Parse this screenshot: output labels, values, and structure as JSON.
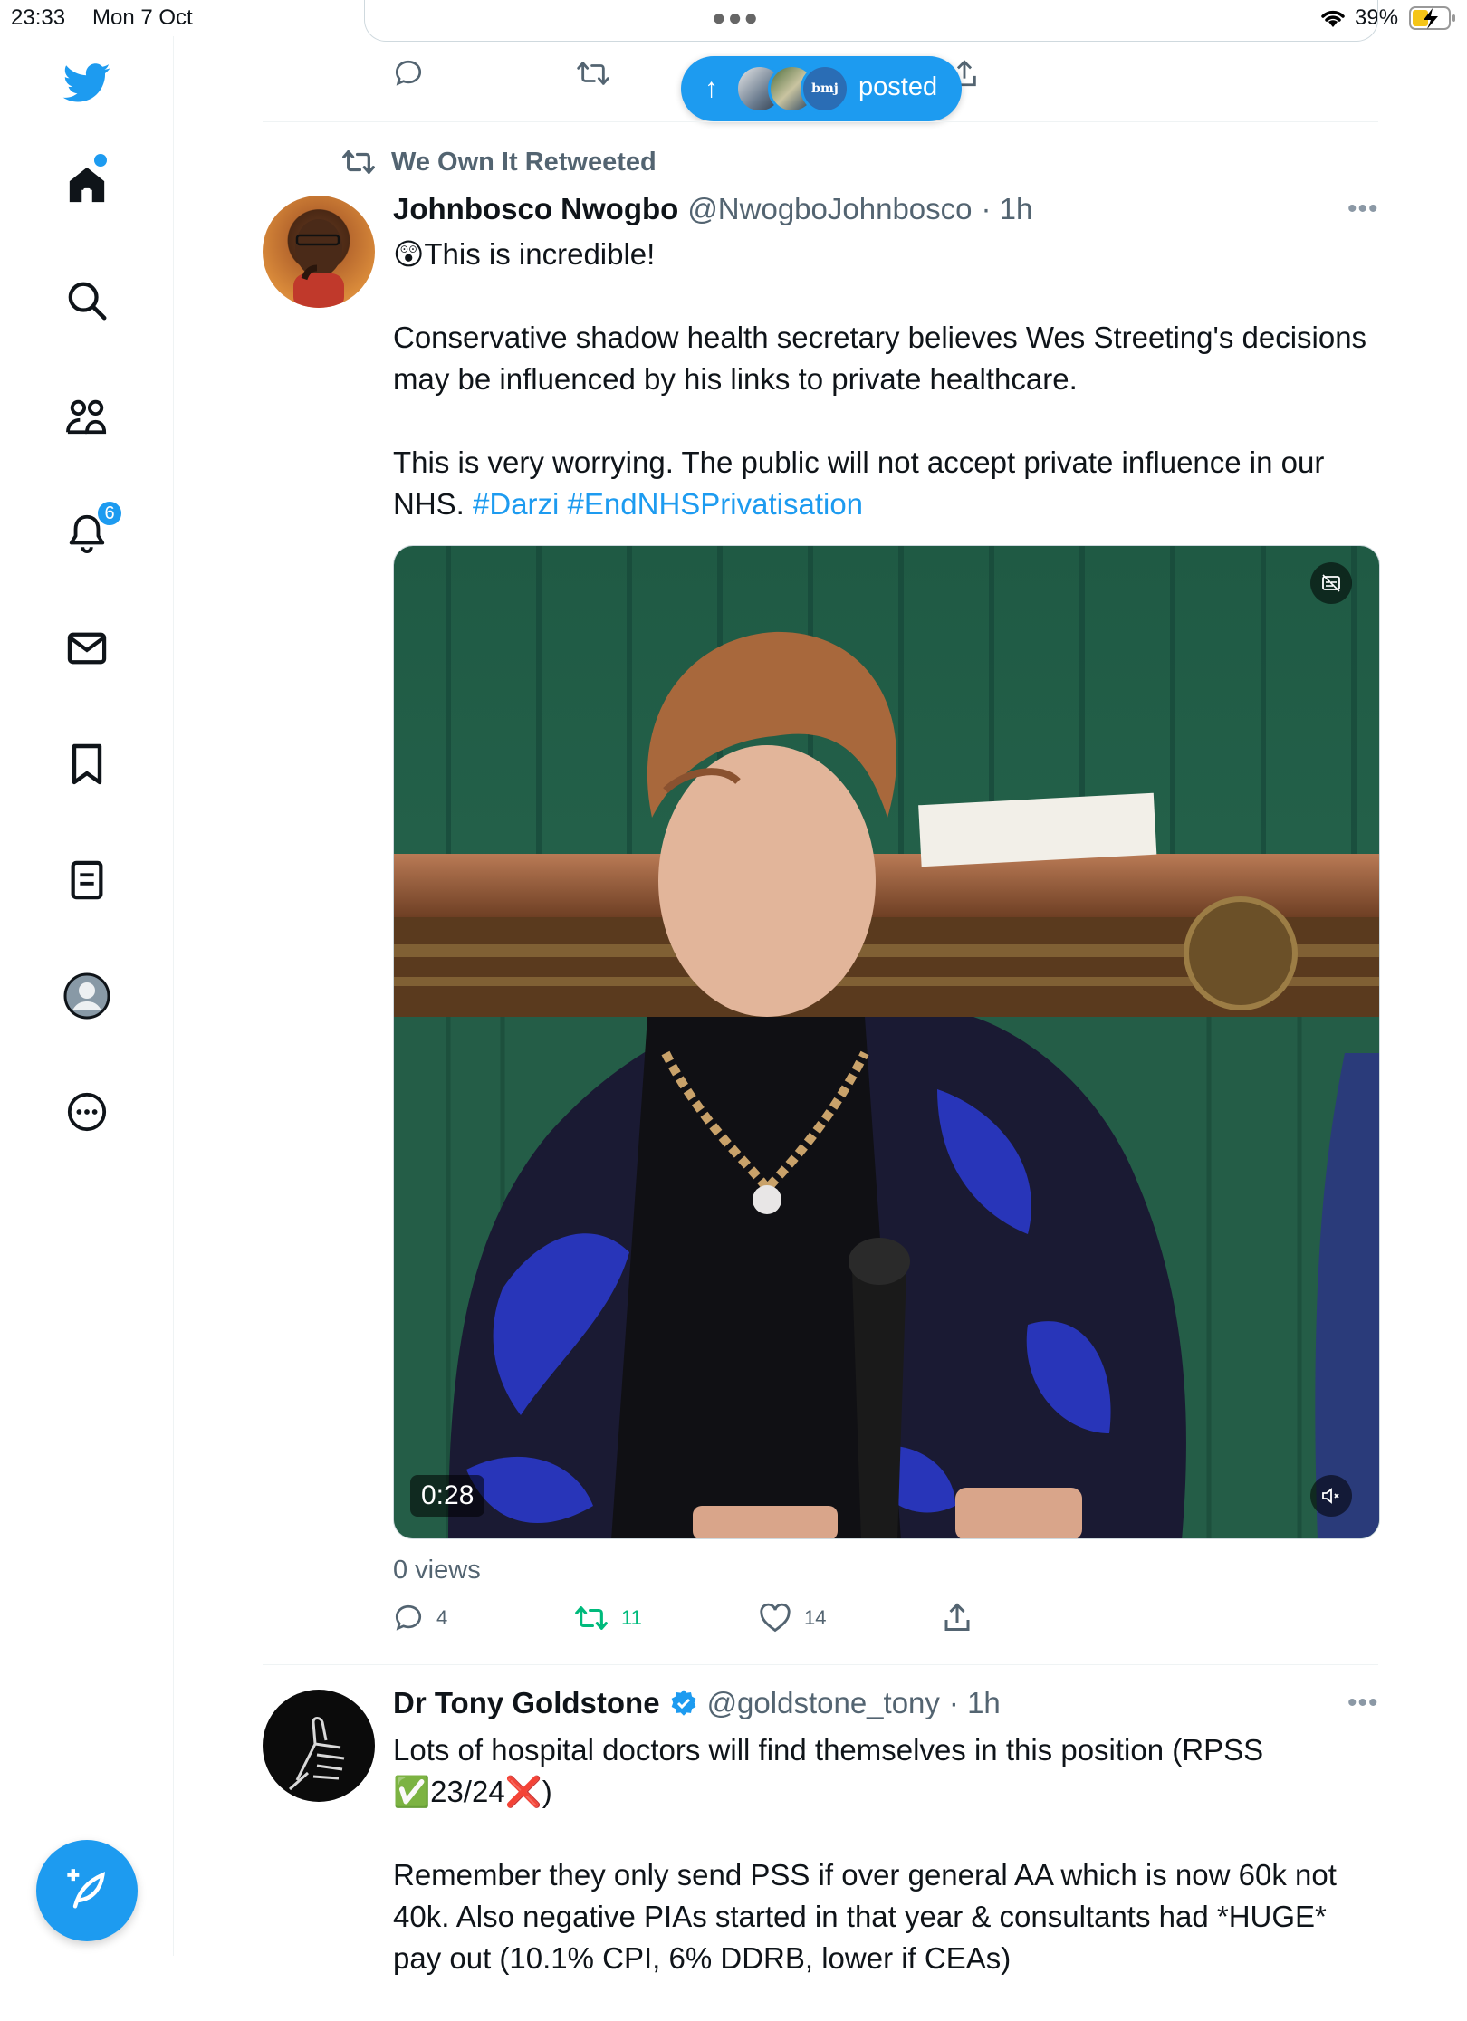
{
  "status_bar": {
    "time": "23:33",
    "date": "Mon 7 Oct",
    "battery": "39%"
  },
  "sidebar": {
    "items": [
      {
        "name": "home",
        "icon": "home-icon"
      },
      {
        "name": "explore",
        "icon": "search-icon"
      },
      {
        "name": "communities",
        "icon": "communities-icon"
      },
      {
        "name": "notifications",
        "icon": "bell-icon",
        "badge": "6"
      },
      {
        "name": "messages",
        "icon": "mail-icon"
      },
      {
        "name": "bookmarks",
        "icon": "bookmark-icon"
      },
      {
        "name": "lists",
        "icon": "list-icon"
      },
      {
        "name": "profile",
        "icon": "profile-icon"
      },
      {
        "name": "more",
        "icon": "more-circle-icon"
      }
    ],
    "compose_icon": "compose-feather-icon"
  },
  "new_posts_pill": {
    "label": "posted",
    "avatar_text": "bmj"
  },
  "retweet": {
    "label": "We Own It Retweeted",
    "author": {
      "display_name": "Johnbosco Nwogbo",
      "handle": "@NwogboJohnbosco",
      "time": "· 1h"
    },
    "text_line1": "😲This is incredible!",
    "text_para2": "Conservative shadow health secretary believes Wes Streeting's decisions may be influenced by his links to private healthcare.",
    "text_para3": "This is very worrying. The public will not accept private influence in our NHS. ",
    "hashtags": [
      "#Darzi",
      "#EndNHSPrivatisation"
    ],
    "video_duration": "0:28",
    "views": "0 views",
    "stats": {
      "replies": "4",
      "retweets": "11",
      "likes": "14"
    }
  },
  "next_tweet": {
    "display_name": "Dr Tony Goldstone",
    "handle": "@goldstone_tony",
    "time": "· 1h",
    "text_para1_line1": "Lots of hospital doctors will find themselves in this position (RPSS",
    "text_para1_line2": "✅23/24❌)",
    "text_para2": "Remember they only send PSS if over general AA which is now 60k not 40k. Also negative PIAs started in that year & consultants had *HUGE* pay out (10.1% CPI, 6% DDRB, lower if CEAs)"
  }
}
